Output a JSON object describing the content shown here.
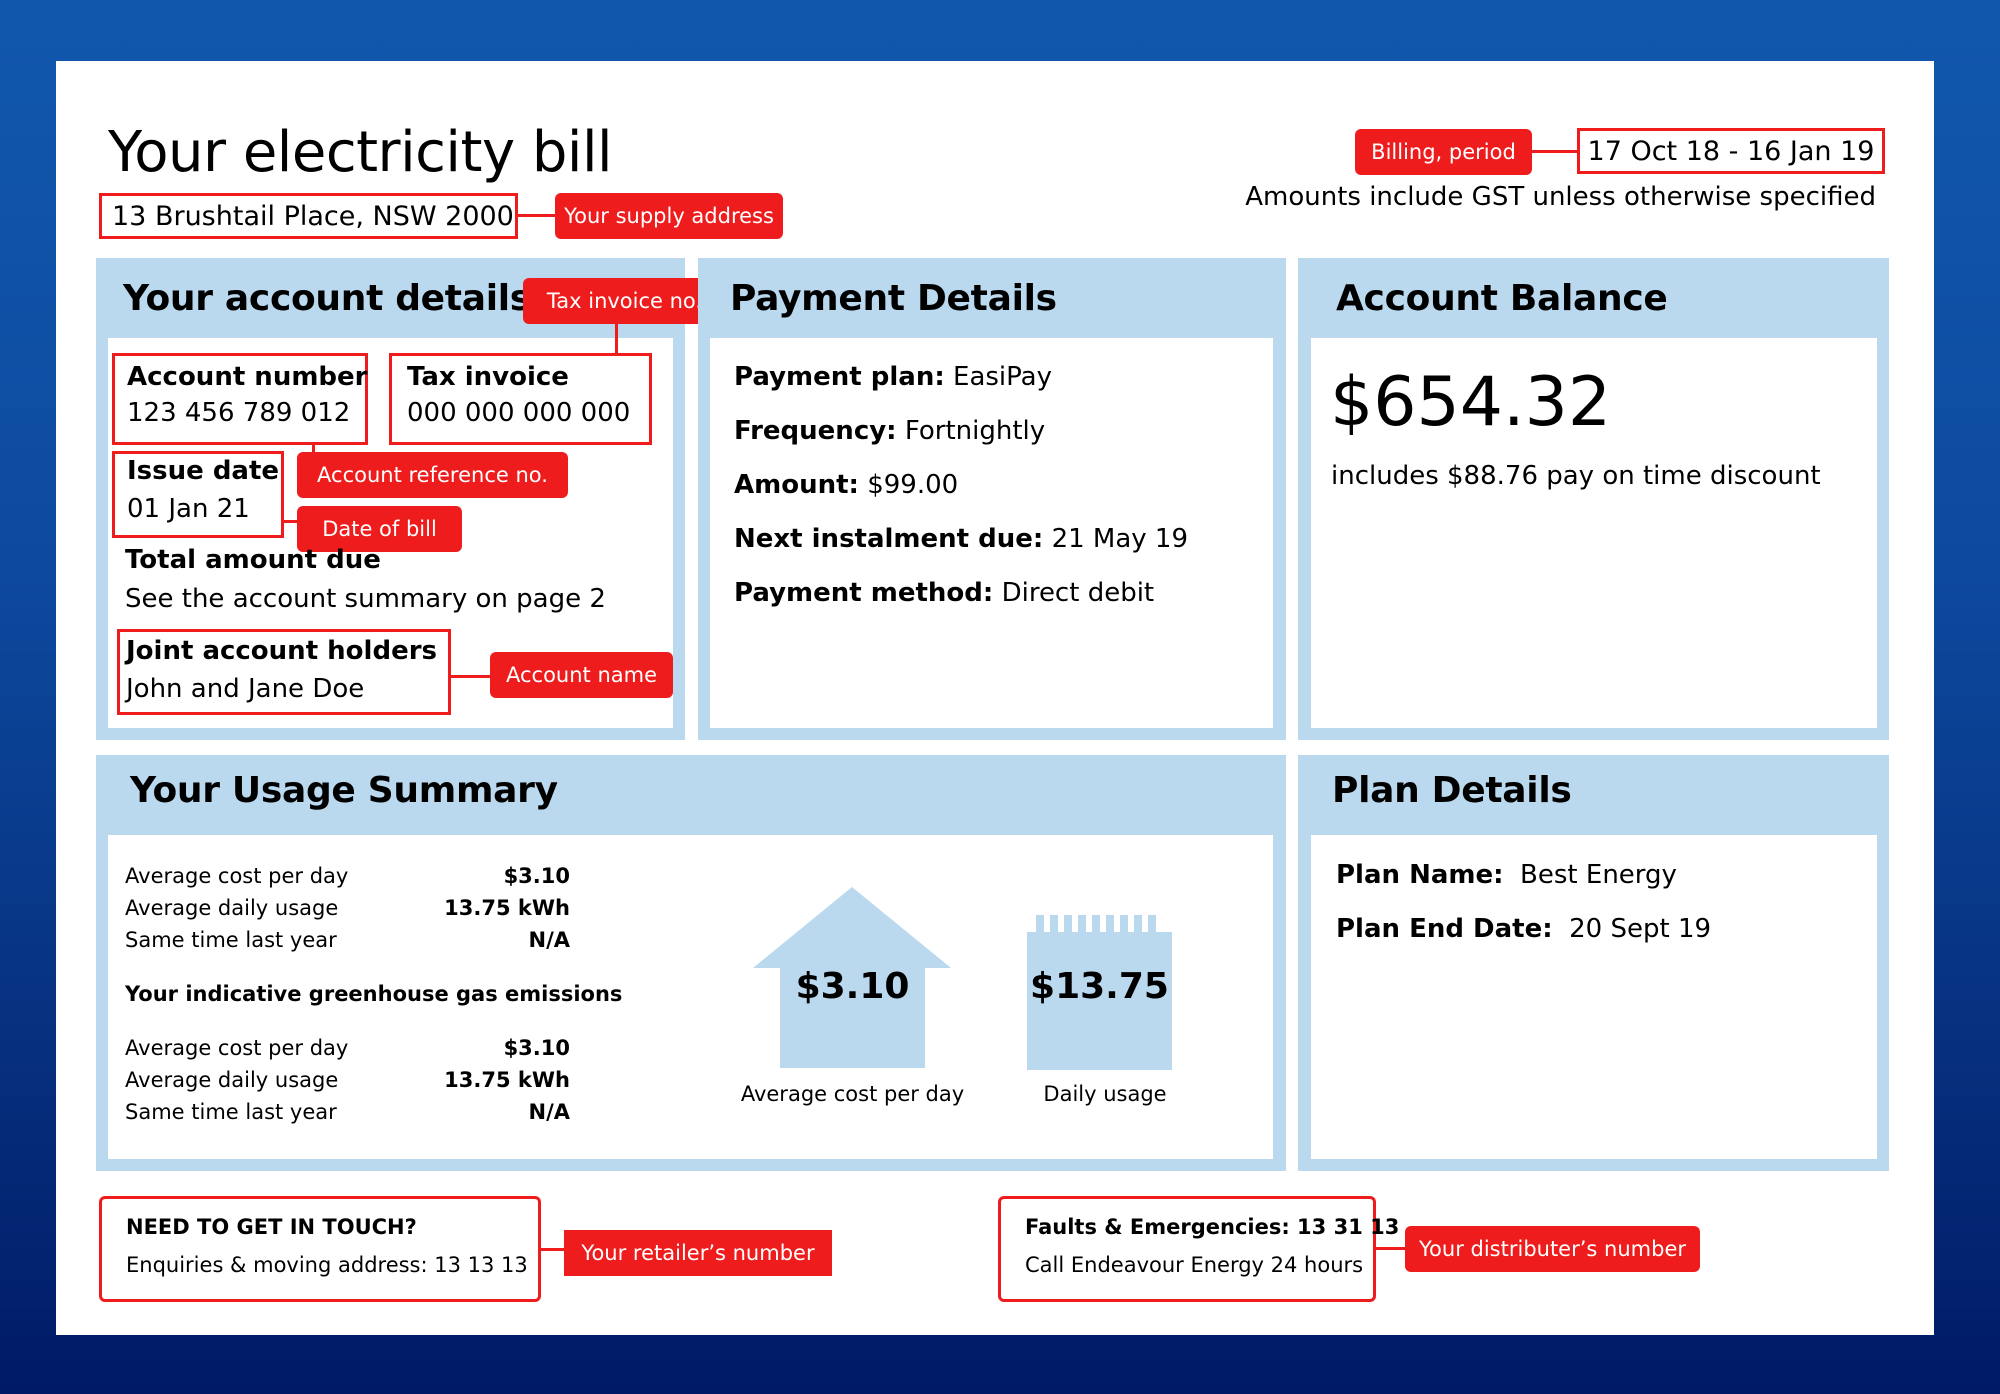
{
  "header": {
    "title": "Your electricity bill",
    "supply_address": "13 Brushtail Place, NSW 2000",
    "supply_address_tag": "Your supply address",
    "billing_period_tag": "Billing, period",
    "billing_period": "17 Oct 18 - 16 Jan 19",
    "gst_note": "Amounts include GST unless otherwise specified"
  },
  "account_details": {
    "title": "Your account details",
    "tax_invoice_tag": "Tax invoice no.",
    "account_number_label": "Account number",
    "account_number": "123 456 789 012",
    "tax_invoice_label": "Tax invoice",
    "tax_invoice": "000 000 000 000",
    "account_reference_tag": "Account reference no.",
    "issue_date_label": "Issue date",
    "issue_date": "01 Jan 21",
    "date_of_bill_tag": "Date of bill",
    "total_due_label": "Total amount due",
    "total_due_text": "See the account summary on page 2",
    "holders_label": "Joint account holders",
    "holders": "John and Jane Doe",
    "account_name_tag": "Account name"
  },
  "payment_details": {
    "title": "Payment Details",
    "rows": [
      {
        "label": "Payment plan:",
        "value": "EasiPay"
      },
      {
        "label": "Frequency:",
        "value": "Fortnightly"
      },
      {
        "label": "Amount:",
        "value": "$99.00"
      },
      {
        "label": "Next instalment due:",
        "value": "21 May 19"
      },
      {
        "label": "Payment method:",
        "value": "Direct debit"
      }
    ]
  },
  "account_balance": {
    "title": "Account Balance",
    "amount": "$654.32",
    "note": "includes $88.76 pay on time discount"
  },
  "usage_summary": {
    "title": "Your Usage Summary",
    "rows_1": [
      {
        "label": "Average cost per day",
        "value": "$3.10"
      },
      {
        "label": "Average daily usage",
        "value": "13.75 kWh"
      },
      {
        "label": "Same time last year",
        "value": "N/A"
      }
    ],
    "emissions_heading": "Your indicative greenhouse gas emissions",
    "rows_2": [
      {
        "label": "Average cost per day",
        "value": "$3.10"
      },
      {
        "label": "Average daily usage",
        "value": "13.75 kWh"
      },
      {
        "label": "Same time last year",
        "value": "N/A"
      }
    ],
    "house_value": "$3.10",
    "house_caption": "Average cost per day",
    "meter_value": "$13.75",
    "meter_caption": "Daily usage"
  },
  "plan_details": {
    "title": "Plan Details",
    "rows": [
      {
        "label": "Plan Name:",
        "value": "Best Energy"
      },
      {
        "label": "Plan End Date:",
        "value": "20 Sept 19"
      }
    ]
  },
  "footer": {
    "retailer_heading": "NEED TO GET IN TOUCH?",
    "retailer_text": "Enquiries & moving address: 13 13 13",
    "retailer_tag": "Your retailer’s number",
    "distributor_heading": "Faults & Emergencies: 13 31 13",
    "distributor_text": "Call Endeavour Energy 24 hours",
    "distributor_tag": "Your distributer’s number"
  },
  "colors": {
    "annotation_red": "#ee1c1c",
    "panel_blue": "#bad9ef",
    "frame_blue": "#1158ad"
  }
}
